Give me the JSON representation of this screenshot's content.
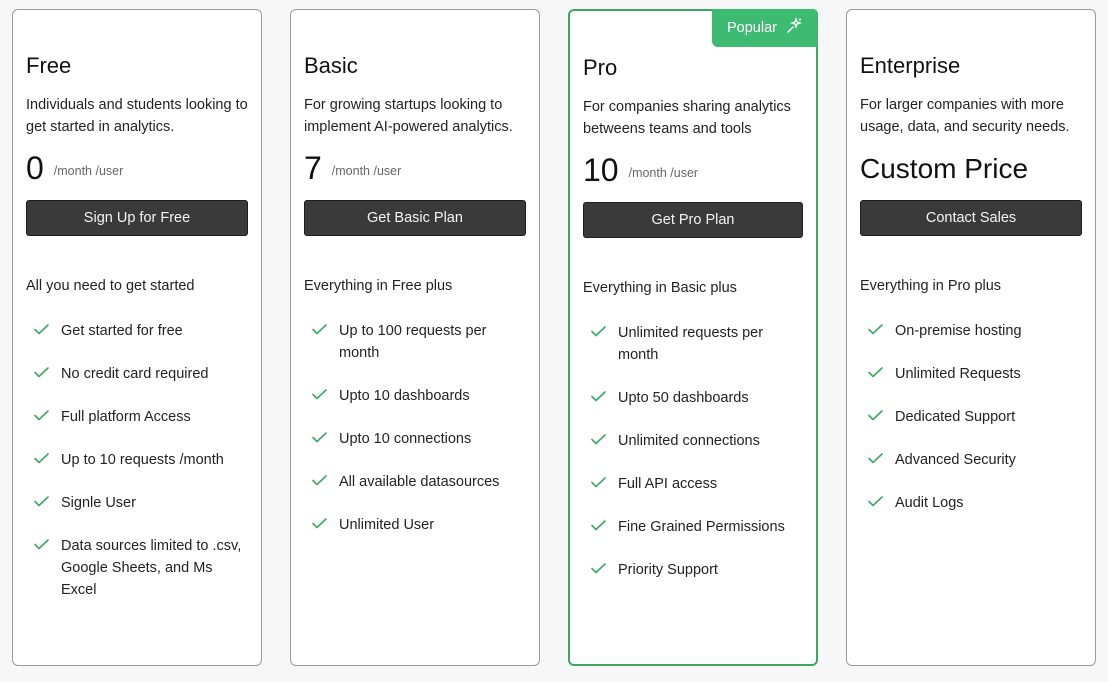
{
  "colors": {
    "accent": "#3dbb72",
    "border_pro": "#3ba862",
    "check": "#3ba862",
    "button": "#3a3a3a"
  },
  "plans": [
    {
      "name": "Free",
      "description": "Individuals and students looking to get started in analytics.",
      "price": "0",
      "price_unit": "/month /user",
      "cta": "Sign Up for Free",
      "intro": "All you need to get started",
      "features": [
        "Get started for free",
        "No credit card required",
        "Full platform Access",
        "Up to 10 requests /month",
        "Signle User",
        "Data sources limited to .csv, Google Sheets, and Ms Excel"
      ]
    },
    {
      "name": "Basic",
      "description": "For growing startups looking to implement AI-powered analytics.",
      "price": "7",
      "price_unit": "/month /user",
      "cta": "Get Basic Plan",
      "intro": "Everything in Free plus",
      "features": [
        "Up to 100 requests per month",
        "Upto 10 dashboards",
        "Upto 10 connections",
        "All available datasources",
        "Unlimited User"
      ]
    },
    {
      "name": "Pro",
      "badge": "Popular",
      "badge_icon": "sparkle-icon",
      "description": "For companies sharing analytics betweens teams and tools",
      "price": "10",
      "price_unit": "/month /user",
      "cta": "Get Pro Plan",
      "intro": "Everything in Basic plus",
      "features": [
        "Unlimited requests per month",
        "Upto 50 dashboards",
        "Unlimited connections",
        "Full API access",
        "Fine Grained Permissions",
        "Priority Support"
      ]
    },
    {
      "name": "Enterprise",
      "description": "For larger companies with more usage, data, and security needs.",
      "price": "Custom Price",
      "cta": "Contact Sales",
      "intro": "Everything in Pro plus",
      "features": [
        "On-premise hosting",
        "Unlimited Requests",
        "Dedicated Support",
        "Advanced Security",
        "Audit Logs"
      ]
    }
  ]
}
